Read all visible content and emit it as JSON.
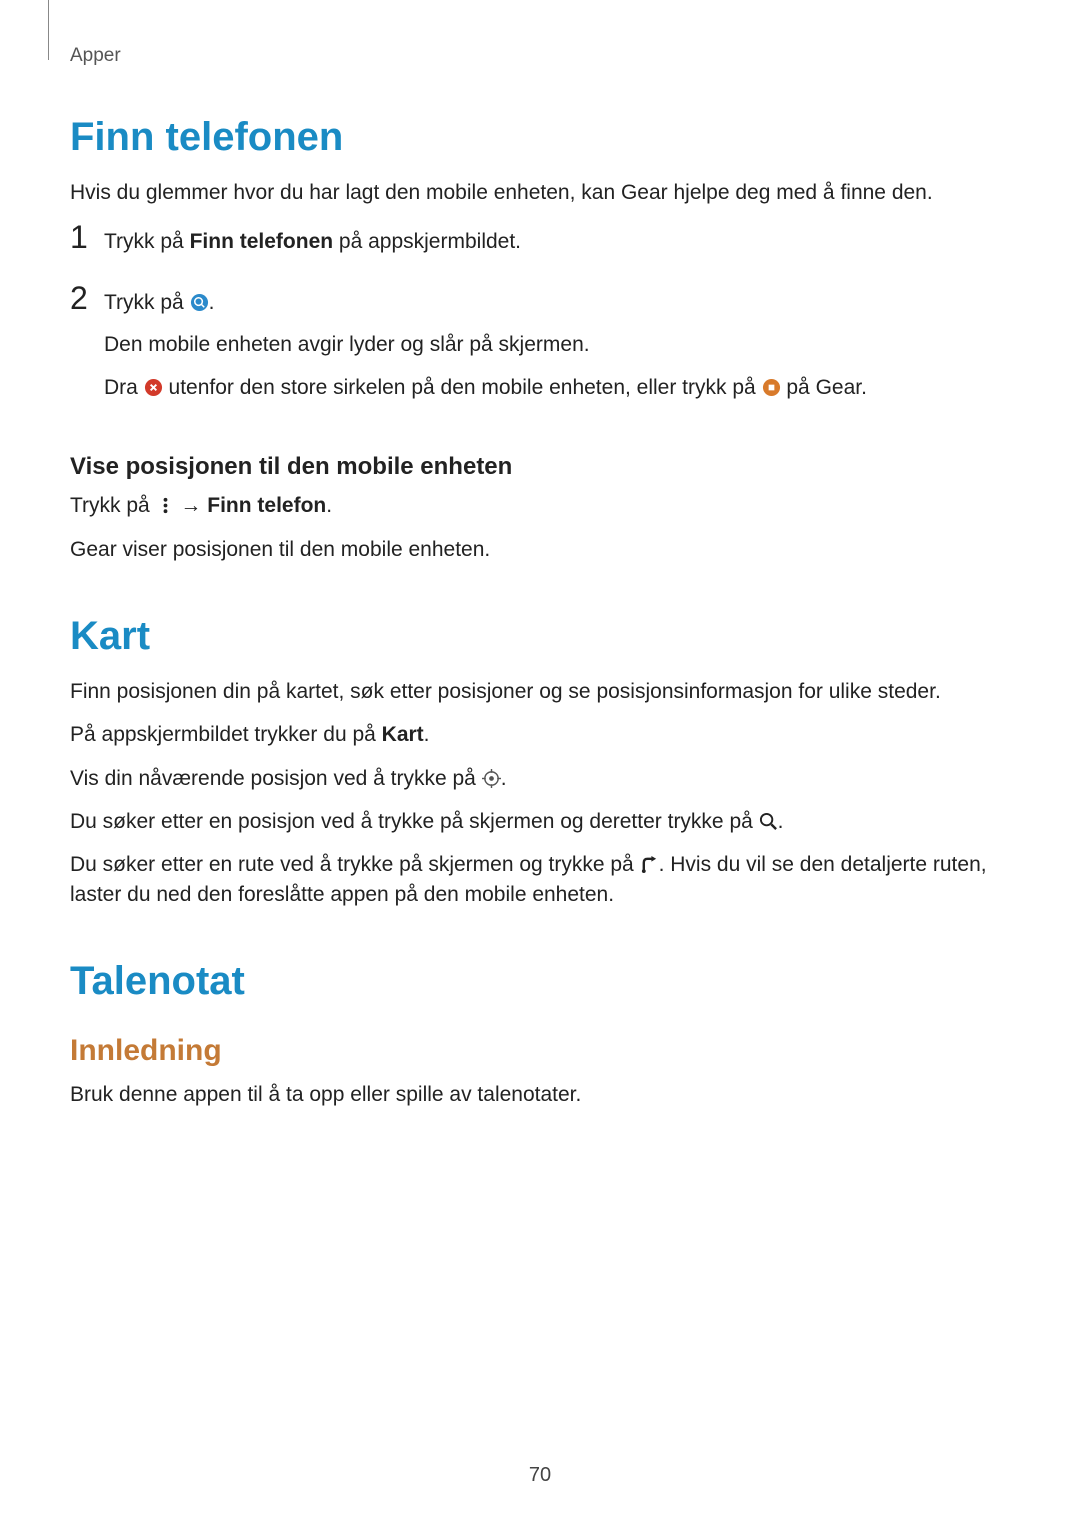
{
  "header": {
    "category": "Apper"
  },
  "sections": {
    "findphone": {
      "title": "Finn telefonen",
      "intro": "Hvis du glemmer hvor du har lagt den mobile enheten, kan Gear hjelpe deg med å finne den.",
      "step1_a": "Trykk på ",
      "step1_b_bold": "Finn telefonen",
      "step1_c": " på appskjermbildet.",
      "step2_line1_a": "Trykk på ",
      "step2_line1_b": ".",
      "step2_line2": "Den mobile enheten avgir lyder og slår på skjermen.",
      "step2_line3_a": "Dra ",
      "step2_line3_b": " utenfor den store sirkelen på den mobile enheten, eller trykk på ",
      "step2_line3_c": " på Gear.",
      "sub_title": "Vise posisjonen til den mobile enheten",
      "sub_p1_a": "Trykk på ",
      "sub_p1_arrow": " → ",
      "sub_p1_bold": "Finn telefon",
      "sub_p1_end": ".",
      "sub_p2": "Gear viser posisjonen til den mobile enheten."
    },
    "maps": {
      "title": "Kart",
      "p1": "Finn posisjonen din på kartet, søk etter posisjoner og se posisjonsinformasjon for ulike steder.",
      "p2_a": "På appskjermbildet trykker du på ",
      "p2_bold": "Kart",
      "p2_end": ".",
      "p3_a": "Vis din nåværende posisjon ved å trykke på ",
      "p3_end": ".",
      "p4_a": "Du søker etter en posisjon ved å trykke på skjermen og deretter trykke på ",
      "p4_end": ".",
      "p5_a": "Du søker etter en rute ved å trykke på skjermen og trykke på ",
      "p5_b": ". Hvis du vil se den detaljerte ruten, laster du ned den foreslåtte appen på den mobile enheten."
    },
    "voicememo": {
      "title": "Talenotat",
      "sub": "Innledning",
      "p1": "Bruk denne appen til å ta opp eller spille av talenotater."
    }
  },
  "pageNumber": "70"
}
